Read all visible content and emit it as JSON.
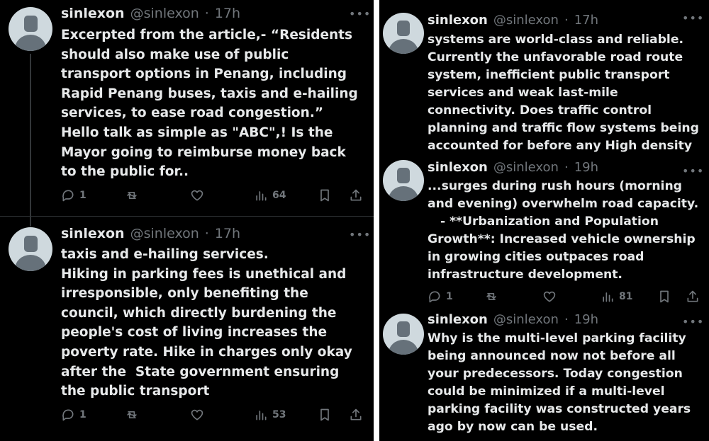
{
  "left": {
    "tweets": [
      {
        "name": "sinlexon",
        "handle": "@sinlexon",
        "separator": "·",
        "time": "17h",
        "text": "Excerpted from the article,- “Residents\nshould also make use of public\ntransport options in Penang, including\nRapid Penang buses, taxis and e-hailing\nservices, to ease road congestion.”\nHello talk as simple as \"ABC\",! Is the\nMayor going to reimburse money back\nto the public for..",
        "replies": "1",
        "retweets": "",
        "likes": "",
        "views": "64"
      },
      {
        "name": "sinlexon",
        "handle": "@sinlexon",
        "separator": "·",
        "time": "17h",
        "text": "taxis and e-hailing services.\nHiking in parking fees is unethical and\nirresponsible, only benefiting the\ncouncil, which directly burdening the\npeople's cost of living increases the\npoverty rate. Hike in charges only okay\nafter the  State government ensuring\nthe public transport",
        "replies": "1",
        "retweets": "",
        "likes": "",
        "views": "53"
      }
    ]
  },
  "right": {
    "tweets": [
      {
        "name": "sinlexon",
        "handle": "@sinlexon",
        "separator": "·",
        "time": "17h",
        "text": "systems are world-class and reliable.\nCurrently the unfavorable road route\nsystem, inefficient public transport\nservices and weak last-mile\nconnectivity. Does traffic control\nplanning and traffic flow systems being\naccounted for before any High density\nresidential / industrial"
      },
      {
        "name": "sinlexon",
        "handle": "@sinlexon",
        "separator": "·",
        "time": "19h",
        "text": "...surges during rush hours (morning\nand evening) overwhelm road capacity.\n   - **Urbanization and Population\nGrowth**: Increased vehicle ownership\nin growing cities outpaces road\ninfrastructure development.",
        "replies": "1",
        "retweets": "",
        "likes": "",
        "views": "81"
      },
      {
        "name": "sinlexon",
        "handle": "@sinlexon",
        "separator": "·",
        "time": "19h",
        "text": "Why is the multi-level parking facility\nbeing announced now not before all\nyour predecessors. Today congestion\ncould be minimized if a multi-level\nparking facility was constructed years\nago by now can be used."
      }
    ]
  },
  "icons": {
    "reply": "reply-icon",
    "retweet": "retweet-icon",
    "like": "heart-icon",
    "views": "views-icon",
    "bookmark": "bookmark-icon",
    "share": "share-icon",
    "more": "more-icon",
    "avatar": "default-avatar-icon"
  },
  "colors": {
    "background": "#000000",
    "primary_text": "#e7e9ea",
    "secondary_text": "#71767b",
    "avatar_bg": "#cfd9de",
    "avatar_fg": "#66717a"
  }
}
